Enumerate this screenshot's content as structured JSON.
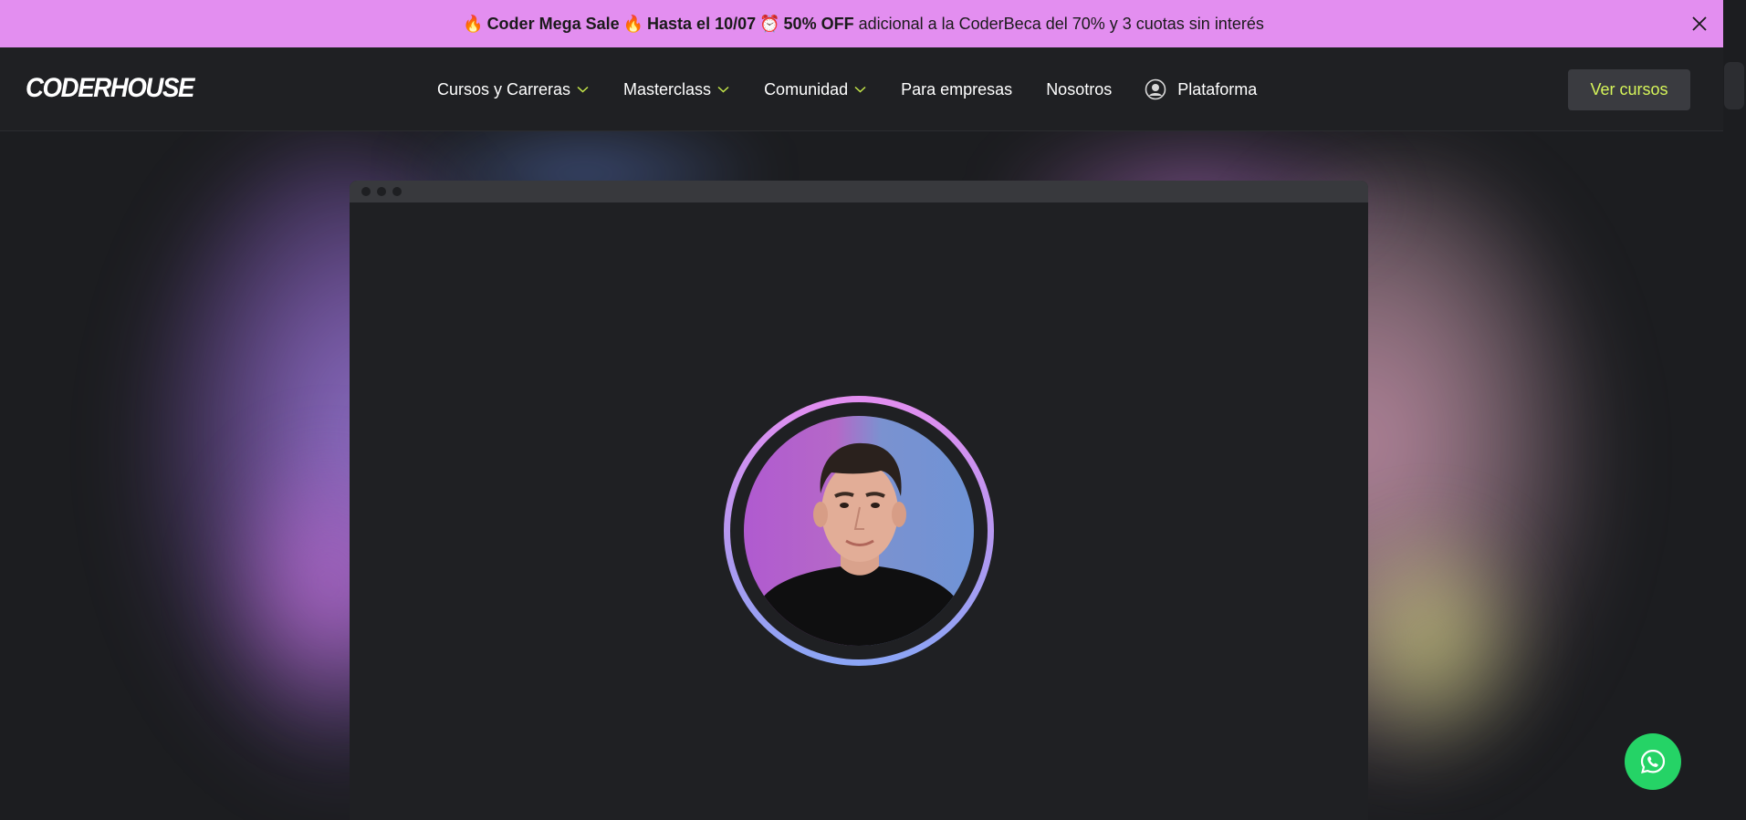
{
  "colors": {
    "promo_bg": "#e38ef0",
    "nav_bg": "#1f2023",
    "page_bg": "#1c1d20",
    "cta_text": "#d6f55a",
    "chevron": "#c6e84a",
    "whatsapp": "#25d366"
  },
  "promo": {
    "emoji_fire": "🔥",
    "part1": "Coder Mega Sale",
    "part2": "Hasta el 10/07",
    "emoji_clock": "⏰",
    "part3": "50% OFF",
    "part4": "adicional a la CoderBeca del 70% y 3 cuotas sin interés",
    "close_icon": "close-icon"
  },
  "nav": {
    "logo": "CODERHOUSE",
    "items": [
      {
        "label": "Cursos y Carreras",
        "dropdown": true
      },
      {
        "label": "Masterclass",
        "dropdown": true
      },
      {
        "label": "Comunidad",
        "dropdown": true
      },
      {
        "label": "Para empresas",
        "dropdown": false
      },
      {
        "label": "Nosotros",
        "dropdown": false
      },
      {
        "label": "Plataforma",
        "icon": "user-circle-icon"
      }
    ],
    "cta": "Ver cursos"
  },
  "hero": {
    "window_dots": 3,
    "avatar_icon": "user-avatar"
  },
  "floating": {
    "icon": "whatsapp-icon"
  }
}
